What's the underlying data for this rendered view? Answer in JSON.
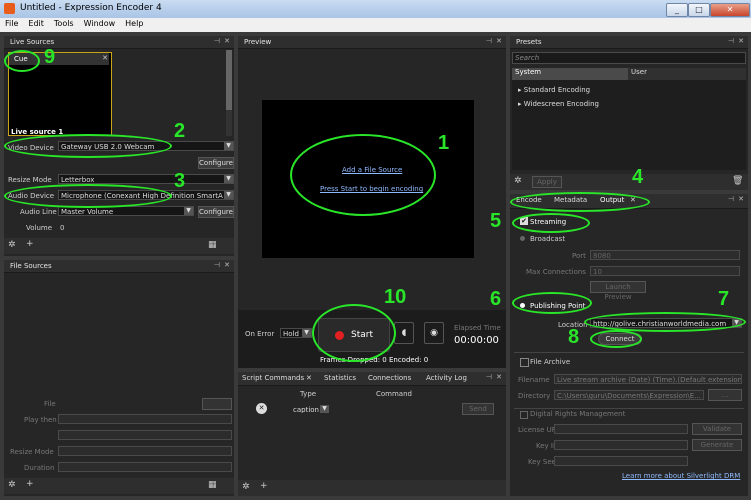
{
  "window": {
    "title": "Untitled - Expression Encoder 4"
  },
  "menu": [
    "File",
    "Edit",
    "Tools",
    "Window",
    "Help"
  ],
  "live_sources": {
    "title": "Live Sources",
    "cue_label": "Cue",
    "source_name": "Live source 1",
    "video_device_label": "Video Device",
    "video_device_value": "Gateway USB 2.0 Webcam",
    "configure": "Configure",
    "resize_mode_label": "Resize Mode",
    "resize_mode_value": "Letterbox",
    "audio_device_label": "Audio Device",
    "audio_device_value": "Microphone (Conexant High Definition SmartA",
    "audio_line_label": "Audio Line",
    "audio_line_value": "Master Volume",
    "volume_label": "Volume",
    "volume_value": "0"
  },
  "file_sources": {
    "title": "File Sources",
    "file_label": "File",
    "play_then_label": "Play then",
    "resize_mode_label": "Resize Mode",
    "duration_label": "Duration"
  },
  "preview": {
    "title": "Preview",
    "add_link": "Add a File Source",
    "start_link": "Press Start to begin encoding",
    "on_error_label": "On Error",
    "on_error_value": "Hold",
    "start_button": "Start",
    "elapsed_label": "Elapsed Time",
    "elapsed_value": "00:00:00",
    "frames_text": "Frames Dropped: 0 Encoded: 0"
  },
  "script_commands": {
    "tabs": [
      "Script Commands",
      "Statistics",
      "Connections",
      "Activity Log"
    ],
    "col_type": "Type",
    "col_command": "Command",
    "type_value": "caption",
    "send_button": "Send"
  },
  "presets": {
    "title": "Presets",
    "search_placeholder": "Search",
    "tab_system": "System",
    "tab_user": "User",
    "items": [
      "Standard Encoding",
      "Widescreen Encoding"
    ],
    "apply_button": "Apply"
  },
  "output": {
    "tabs": [
      "Encode",
      "Metadata",
      "Output"
    ],
    "streaming_label": "Streaming",
    "broadcast_label": "Broadcast",
    "port_label": "Port",
    "port_value": "8080",
    "max_conn_label": "Max Connections",
    "max_conn_value": "10",
    "launch_preview": "Launch Preview",
    "publishing_point_label": "Publishing Point",
    "location_label": "Location",
    "location_value": "http://golive.christianworldmedia.com",
    "connect_button": "Connect",
    "file_archive_label": "File Archive",
    "filename_label": "Filename",
    "filename_value": "Live stream archive (Date) (Time).(Default extension)",
    "directory_label": "Directory",
    "directory_value": "C:\\Users\\guru\\Documents\\Expression\\E...",
    "browse_button": "...",
    "drm_label": "Digital Rights Management",
    "license_url_label": "License URL",
    "validate_button": "Validate",
    "key_id_label": "Key ID",
    "generate_button": "Generate",
    "key_seed_label": "Key Seed",
    "drm_link": "Learn more about Silverlight DRM"
  },
  "annotations": [
    "1",
    "2",
    "3",
    "4",
    "5",
    "6",
    "7",
    "8",
    "9",
    "10"
  ],
  "colors": {
    "annotation": "#29e629",
    "link": "#8fbaff",
    "record": "#e02020"
  }
}
